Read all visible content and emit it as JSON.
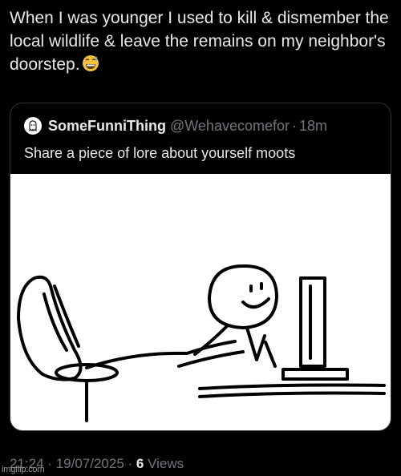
{
  "tweet": {
    "text": "When I was younger I used to kill & dismember the local wildlife & leave the remains on my neighbor's doorstep.",
    "emoji_icon": "grinning-face-with-sweat-icon"
  },
  "quoted_tweet": {
    "display_name": "SomeFunniThing",
    "handle": "@Wehavecomefor",
    "separator": "·",
    "time": "18m",
    "text": "Share a piece of lore about yourself moots",
    "avatar_icon": "ghost-avatar-icon",
    "image": "stickman-at-computer-drawing"
  },
  "meta": {
    "time": "21:24",
    "separator1": "·",
    "date": "19/07/2025",
    "separator2": "·",
    "views_count": "6",
    "views_label": "Views"
  },
  "watermark": {
    "text": "imgflip.com"
  },
  "colors": {
    "background": "#000000",
    "primary_text": "#e7e9ea",
    "secondary_text": "#71767b",
    "border": "#2f3336"
  }
}
